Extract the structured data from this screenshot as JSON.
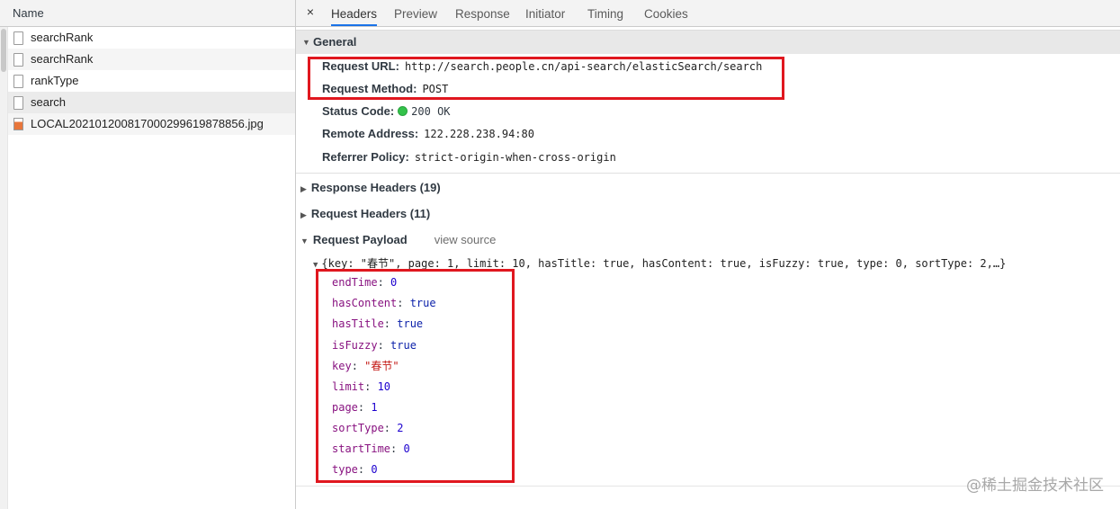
{
  "left": {
    "header": "Name",
    "requests": [
      {
        "name": "searchRank",
        "icon": "file-icon"
      },
      {
        "name": "searchRank",
        "icon": "file-icon"
      },
      {
        "name": "rankType",
        "icon": "file-icon"
      },
      {
        "name": "search",
        "icon": "file-icon"
      },
      {
        "name": "LOCAL20210120081700029961987885‌6.jpg",
        "icon": "image-icon"
      }
    ]
  },
  "tabs": {
    "close": "×",
    "items": [
      "Headers",
      "Preview",
      "Response",
      "Initiator",
      "Timing",
      "Cookies"
    ],
    "active": "Headers"
  },
  "general": {
    "title": "General",
    "rows": [
      {
        "key": "Request URL:",
        "value": "http://search.people.cn/api-search/elasticSearch/search"
      },
      {
        "key": "Request Method:",
        "value": "POST"
      },
      {
        "key": "Status Code:",
        "value": "200 OK"
      },
      {
        "key": "Remote Address:",
        "value": "122.228.238.94:80"
      },
      {
        "key": "Referrer Policy:",
        "value": "strict-origin-when-cross-origin"
      }
    ]
  },
  "response_headers": "Response Headers (19)",
  "request_headers": "Request Headers (11)",
  "payload": {
    "title": "Request Payload",
    "view_source": "view source",
    "summary": "{key: \"春节\", page: 1, limit: 10, hasTitle: true, hasContent: true, isFuzzy: true, type: 0, sortType: 2,…}",
    "props": [
      {
        "key": "endTime",
        "value": "0",
        "kind": "num"
      },
      {
        "key": "hasContent",
        "value": "true",
        "kind": "bool"
      },
      {
        "key": "hasTitle",
        "value": "true",
        "kind": "bool"
      },
      {
        "key": "isFuzzy",
        "value": "true",
        "kind": "bool"
      },
      {
        "key": "key",
        "value": "\"春节\"",
        "kind": "str"
      },
      {
        "key": "limit",
        "value": "10",
        "kind": "num"
      },
      {
        "key": "page",
        "value": "1",
        "kind": "num"
      },
      {
        "key": "sortType",
        "value": "2",
        "kind": "num"
      },
      {
        "key": "startTime",
        "value": "0",
        "kind": "num"
      },
      {
        "key": "type",
        "value": "0",
        "kind": "num"
      }
    ]
  },
  "watermark": "@稀土掘金技术社区",
  "colors": {
    "highlight": "#e0171f",
    "status_ok": "#33c24a",
    "tab_active": "#1a73e8"
  }
}
